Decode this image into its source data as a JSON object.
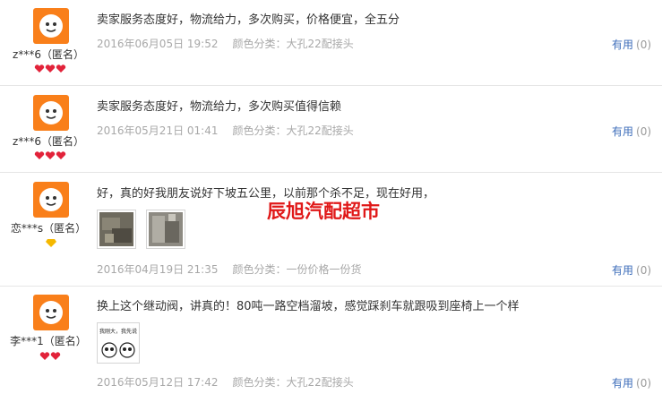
{
  "reviews": [
    {
      "user": "z***6（匿名）",
      "text": "卖家服务态度好，物流给力，多次购买，价格便宜，全五分",
      "date": "2016年06月05日 19:52",
      "color_class": "颜色分类：大孔22配接头",
      "useful_label": "有用",
      "useful_count": "(0)",
      "rank_badge": "three-red-hearts"
    },
    {
      "user": "z***6（匿名）",
      "text": "卖家服务态度好，物流给力，多次购买值得信赖",
      "date": "2016年05月21日 01:41",
      "color_class": "颜色分类：大孔22配接头",
      "useful_label": "有用",
      "useful_count": "(0)",
      "rank_badge": "three-red-hearts"
    },
    {
      "user": "恋***s（匿名）",
      "text": "好，真的好我朋友说好下坡五公里，以前那个杀不足，现在好用，",
      "watermark": "辰旭汽配超市",
      "date": "2016年04月19日 21:35",
      "color_class": "颜色分类：一份价格一份货",
      "useful_label": "有用",
      "useful_count": "(0)",
      "rank_badge": "one-yellow-diamond"
    },
    {
      "user": "李***1（匿名）",
      "text": "换上这个继动阀，讲真的！80吨一路空档溜坡，感觉踩刹车就跟吸到座椅上一个样",
      "date": "2016年05月12日 17:42",
      "color_class": "颜色分类：大孔22配接头",
      "useful_label": "有用",
      "useful_count": "(0)",
      "rank_badge": "two-red-hearts",
      "meme_caption": "我刚大，我先说"
    }
  ],
  "colors": {
    "accent_link": "#3d6dba",
    "avatar_orange": "#f97f1a",
    "watermark_red": "#e01818"
  }
}
